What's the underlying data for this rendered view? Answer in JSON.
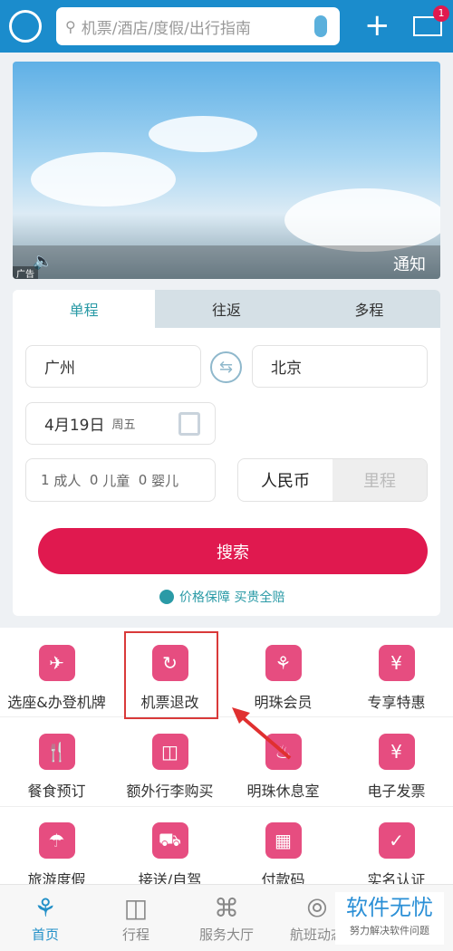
{
  "header": {
    "search_placeholder": "机票/酒店/度假/出行指南",
    "badge_count": "1",
    "colors": {
      "bar": "#1b8ccc"
    }
  },
  "banner": {
    "ad_label": "广告",
    "notice_label": "通知"
  },
  "booking": {
    "tabs": [
      {
        "label": "单程",
        "active": true
      },
      {
        "label": "往返"
      },
      {
        "label": "多程"
      }
    ],
    "from": "广州",
    "to": "北京",
    "date": "4月19日",
    "weekday": "周五",
    "passengers": {
      "adult_count": "1",
      "adult": "成人",
      "child_count": "0",
      "child": "儿童",
      "infant_count": "0",
      "infant": "婴儿"
    },
    "currency": {
      "selected": "人民币",
      "other": "里程"
    },
    "search_label": "搜索",
    "guarantee": "价格保障 买贵全赔",
    "accent": "#e0194f"
  },
  "services": [
    {
      "label": "选座&办登机牌",
      "icon": "boarding-pass-icon"
    },
    {
      "label": "机票退改",
      "icon": "ticket-change-icon",
      "highlighted": true
    },
    {
      "label": "明珠会员",
      "icon": "member-icon"
    },
    {
      "label": "专享特惠",
      "icon": "user-discount-icon"
    },
    {
      "label": "餐食预订",
      "icon": "cutlery-icon"
    },
    {
      "label": "额外行李购买",
      "icon": "luggage-icon"
    },
    {
      "label": "明珠休息室",
      "icon": "lounge-icon"
    },
    {
      "label": "电子发票",
      "icon": "invoice-icon"
    },
    {
      "label": "旅游度假",
      "icon": "umbrella-icon"
    },
    {
      "label": "接送/自驾",
      "icon": "car-icon"
    },
    {
      "label": "付款码",
      "icon": "qr-code-icon"
    },
    {
      "label": "实名认证",
      "icon": "shield-icon"
    }
  ],
  "nav": [
    {
      "label": "首页",
      "active": true
    },
    {
      "label": "行程"
    },
    {
      "label": "服务大厅"
    },
    {
      "label": "航班动态"
    }
  ],
  "watermark": {
    "title": "软件无忧",
    "subtitle": "努力解决软件问题"
  }
}
